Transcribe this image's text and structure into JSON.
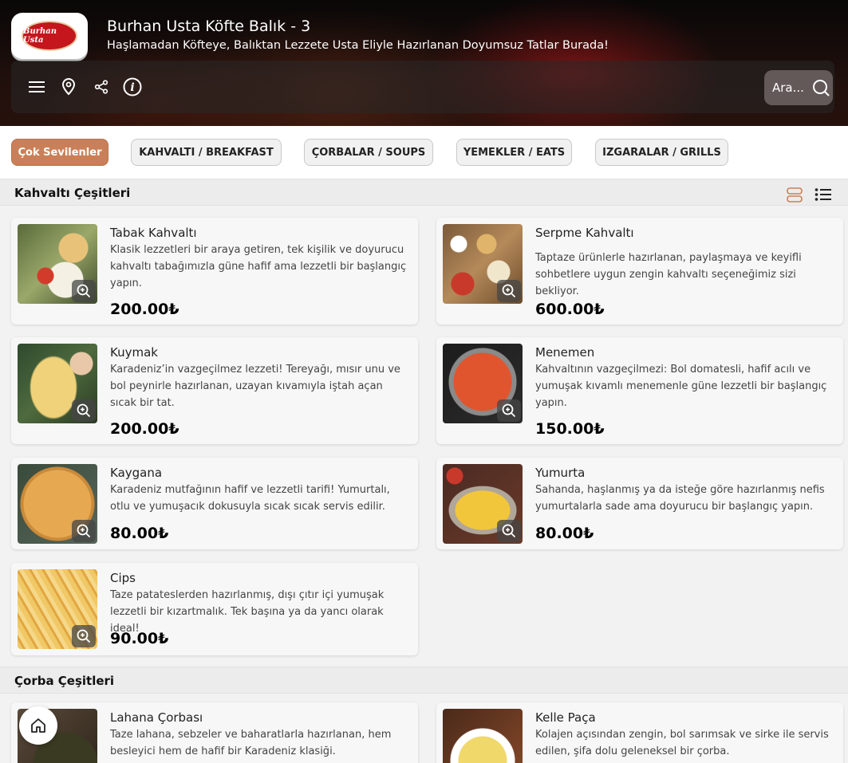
{
  "restaurant": {
    "logo_text": "Burhan Usta",
    "title": "Burhan Usta Köfte Balık - 3",
    "subtitle": "Haşlamadan Köfteye, Balıktan Lezzete Usta Eliyle Hazırlanan Doyumsuz Tatlar Burada!"
  },
  "toolbar": {
    "icons": [
      "menu-icon",
      "location-pin-icon",
      "share-icon",
      "info-icon"
    ],
    "search_label": "Ara..."
  },
  "tabs": [
    {
      "label": "Çok Sevilenler",
      "active": true
    },
    {
      "label": "KAHVALTI / BREAKFAST",
      "active": false
    },
    {
      "label": "ÇORBALAR / SOUPS",
      "active": false
    },
    {
      "label": "YEMEKLER / EATS",
      "active": false
    },
    {
      "label": "IZGARALAR / GRILLS",
      "active": false
    }
  ],
  "sections": [
    {
      "title": "Kahvaltı Çeşitleri",
      "items": [
        {
          "name": "Tabak Kahvaltı",
          "desc": "Klasik lezzetleri bir araya getiren, tek kişilik ve doyurucu kahvaltı tabağımızla güne hafif ama lezzetli bir başlangıç yapın.",
          "price": "200.00₺"
        },
        {
          "name": "Serpme Kahvaltı",
          "desc": "Taptaze ürünlerle hazırlanan, paylaşmaya ve keyifli sohbetlere uygun zengin kahvaltı seçeneğimiz sizi bekliyor.",
          "price": "600.00₺"
        },
        {
          "name": "Kuymak",
          "desc": "Karadeniz’in vazgeçilmez lezzeti! Tereyağı, mısır unu ve bol peynirle hazırlanan, uzayan kıvamıyla iştah açan sıcak bir tat.",
          "price": "200.00₺"
        },
        {
          "name": "Menemen",
          "desc": "Kahvaltının vazgeçilmezi: Bol domatesli, hafif acılı ve yumuşak kıvamlı menemenle güne lezzetli bir başlangıç yapın.",
          "price": "150.00₺"
        },
        {
          "name": "Kaygana",
          "desc": "Karadeniz mutfağının hafif ve lezzetli tarifi! Yumurtalı, otlu ve yumuşacık dokusuyla sıcak sıcak servis edilir.",
          "price": "80.00₺"
        },
        {
          "name": "Yumurta",
          "desc": "Sahanda, haşlanmış ya da isteğe göre hazırlanmış nefis yumurtalarla sade ama doyurucu bir başlangıç yapın.",
          "price": "80.00₺"
        },
        {
          "name": "Cips",
          "desc": "Taze patateslerden hazırlanmış, dışı çıtır içi yumuşak lezzetli bir kızartmalık. Tek başına ya da yancı olarak ideal!",
          "price": "90.00₺"
        }
      ]
    },
    {
      "title": "Çorba Çeşitleri",
      "items": [
        {
          "name": "Lahana Çorbası",
          "desc": "Taze lahana, sebzeler ve baharatlarla hazırlanan, hem besleyici hem de hafif bir Karadeniz klasiği.",
          "price": ""
        },
        {
          "name": "Kelle Paça",
          "desc": "Kolajen açısından zengin, bol sarımsak ve sirke ile servis edilen, şifa dolu geleneksel bir çorba.",
          "price": ""
        }
      ]
    }
  ],
  "colors": {
    "accent": "#c98058",
    "brand_red": "#c4161c"
  }
}
